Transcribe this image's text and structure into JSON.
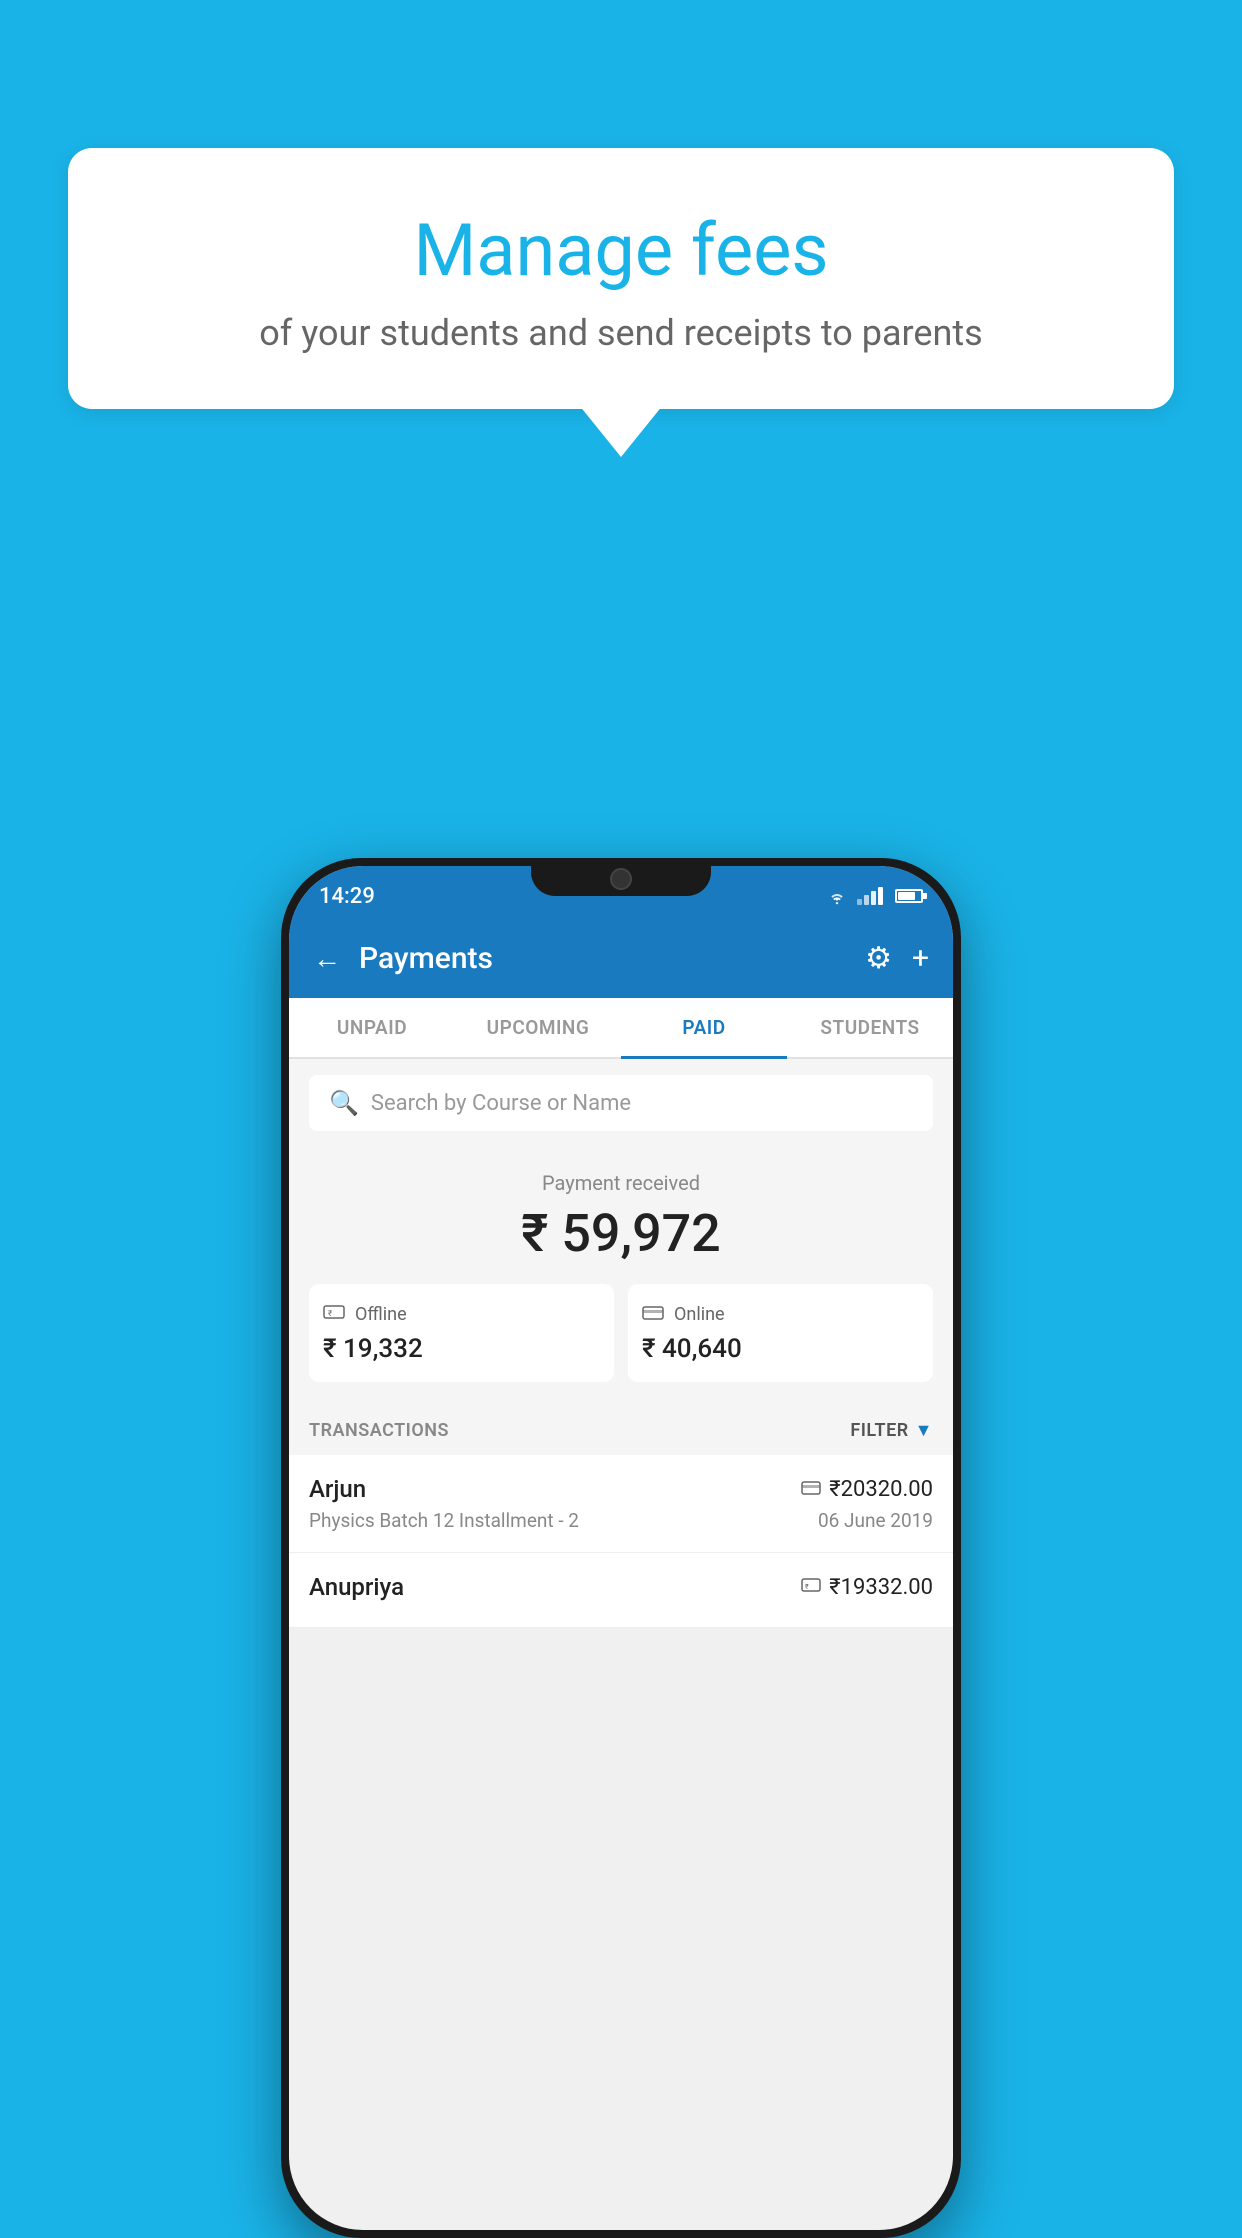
{
  "background_color": "#1ab3e8",
  "bubble": {
    "title": "Manage fees",
    "subtitle": "of your students and send receipts to parents"
  },
  "status_bar": {
    "time": "14:29"
  },
  "header": {
    "title": "Payments",
    "back_label": "←",
    "settings_label": "⚙",
    "add_label": "+"
  },
  "tabs": [
    {
      "label": "UNPAID",
      "active": false
    },
    {
      "label": "UPCOMING",
      "active": false
    },
    {
      "label": "PAID",
      "active": true
    },
    {
      "label": "STUDENTS",
      "active": false
    }
  ],
  "search": {
    "placeholder": "Search by Course or Name"
  },
  "payment_summary": {
    "label": "Payment received",
    "amount": "₹ 59,972",
    "offline_label": "Offline",
    "offline_amount": "₹ 19,332",
    "online_label": "Online",
    "online_amount": "₹ 40,640"
  },
  "transactions": {
    "label": "TRANSACTIONS",
    "filter_label": "FILTER",
    "rows": [
      {
        "name": "Arjun",
        "course": "Physics Batch 12 Installment - 2",
        "amount": "₹20320.00",
        "date": "06 June 2019",
        "type": "online"
      },
      {
        "name": "Anupriya",
        "course": "",
        "amount": "₹19332.00",
        "date": "",
        "type": "offline"
      }
    ]
  }
}
